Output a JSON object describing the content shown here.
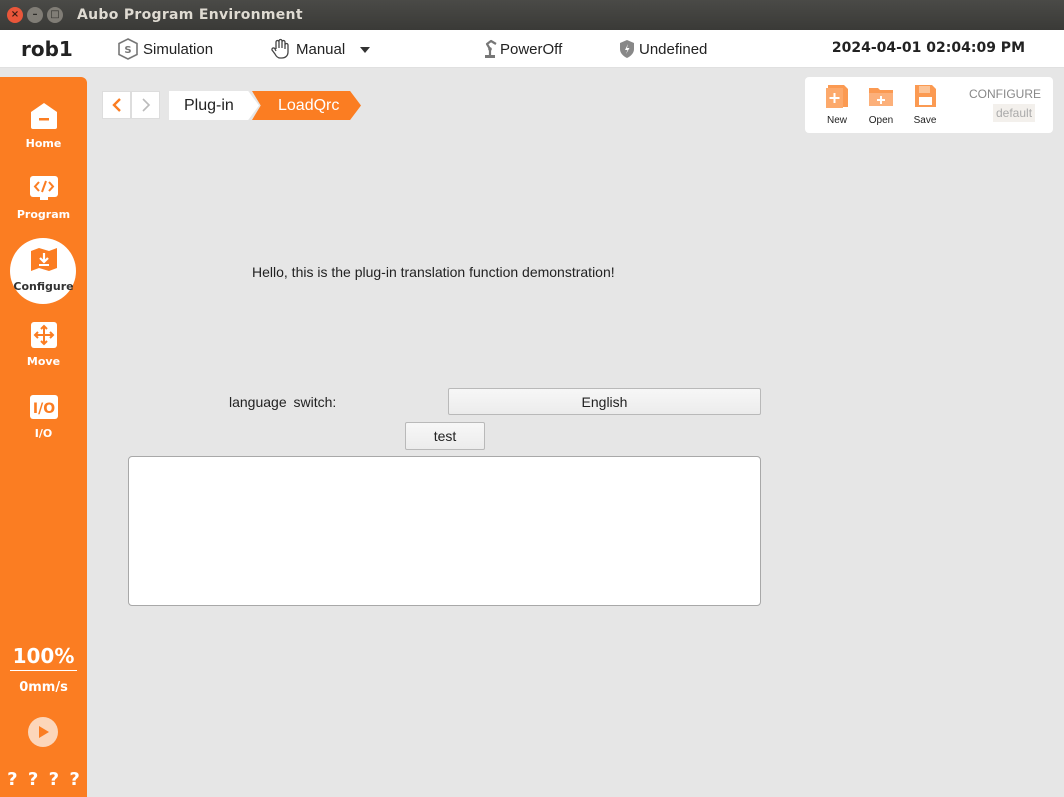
{
  "window": {
    "title": "Aubo Program Environment"
  },
  "status": {
    "robot": "rob1",
    "mode": "Simulation",
    "control": "Manual",
    "power": "PowerOff",
    "safety": "Undefined",
    "datetime": "2024-04-01 02:04:09 PM"
  },
  "sidebar": {
    "items": [
      {
        "label": "Home",
        "icon": "home-icon"
      },
      {
        "label": "Program",
        "icon": "code-icon"
      },
      {
        "label": "Configure",
        "icon": "configure-icon",
        "active": true
      },
      {
        "label": "Move",
        "icon": "move-arrows-icon"
      },
      {
        "label": "I/O",
        "icon": "io-icon"
      }
    ],
    "speed_percent": "100%",
    "speed_value": "0mm/s",
    "help_marks": [
      "?",
      "?",
      "?",
      "?"
    ]
  },
  "breadcrumb": {
    "items": [
      "Plug-in",
      "LoadQrc"
    ]
  },
  "config_panel": {
    "new_label": "New",
    "open_label": "Open",
    "save_label": "Save",
    "title": "CONFIGURE",
    "value": "default"
  },
  "main": {
    "hello_text": "Hello, this is the plug-in translation function demonstration!",
    "language_label": "language  switch:",
    "language_value": "English",
    "test_label": "test",
    "output_text": ""
  },
  "colors": {
    "accent": "#fb7d22",
    "accent_light": "#fcd6ba",
    "background": "#e6e6e6"
  }
}
